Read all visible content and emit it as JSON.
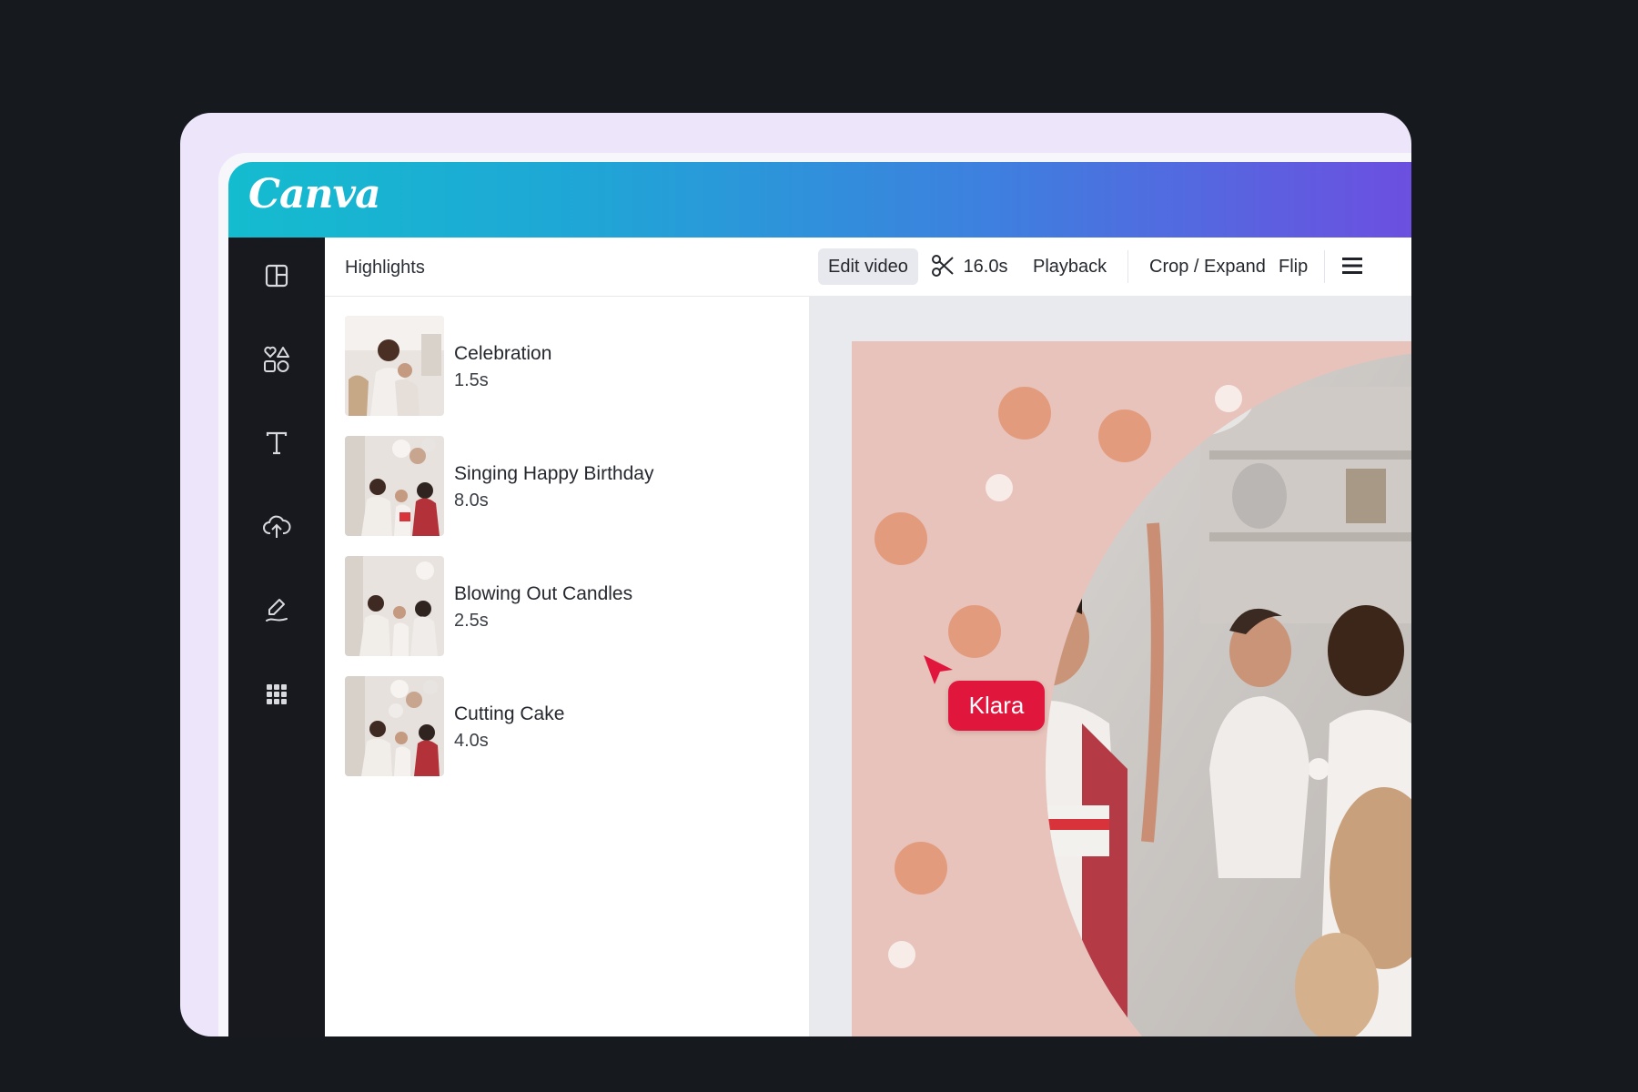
{
  "app": {
    "logo_text": "Canva",
    "brand_gradient": [
      "#14bccf",
      "#3e7fdf",
      "#6c4fe0"
    ]
  },
  "sidebar": {
    "icons": [
      "templates-icon",
      "elements-icon",
      "text-icon",
      "uploads-icon",
      "draw-icon",
      "apps-icon"
    ]
  },
  "panel": {
    "title": "Highlights",
    "clips": [
      {
        "title": "Celebration",
        "duration": "1.5s"
      },
      {
        "title": "Singing Happy Birthday",
        "duration": "8.0s"
      },
      {
        "title": "Blowing Out Candles",
        "duration": "2.5s"
      },
      {
        "title": "Cutting Cake",
        "duration": "4.0s"
      }
    ]
  },
  "toolbar": {
    "edit_video": "Edit video",
    "duration": "16.0s",
    "playback": "Playback",
    "crop_expand": "Crop / Expand",
    "flip": "Flip"
  },
  "collaborator": {
    "name": "Klara",
    "color": "#e1163d"
  },
  "canvas": {
    "background": "#e8c3bb",
    "dot_color": "#e39b7e"
  }
}
